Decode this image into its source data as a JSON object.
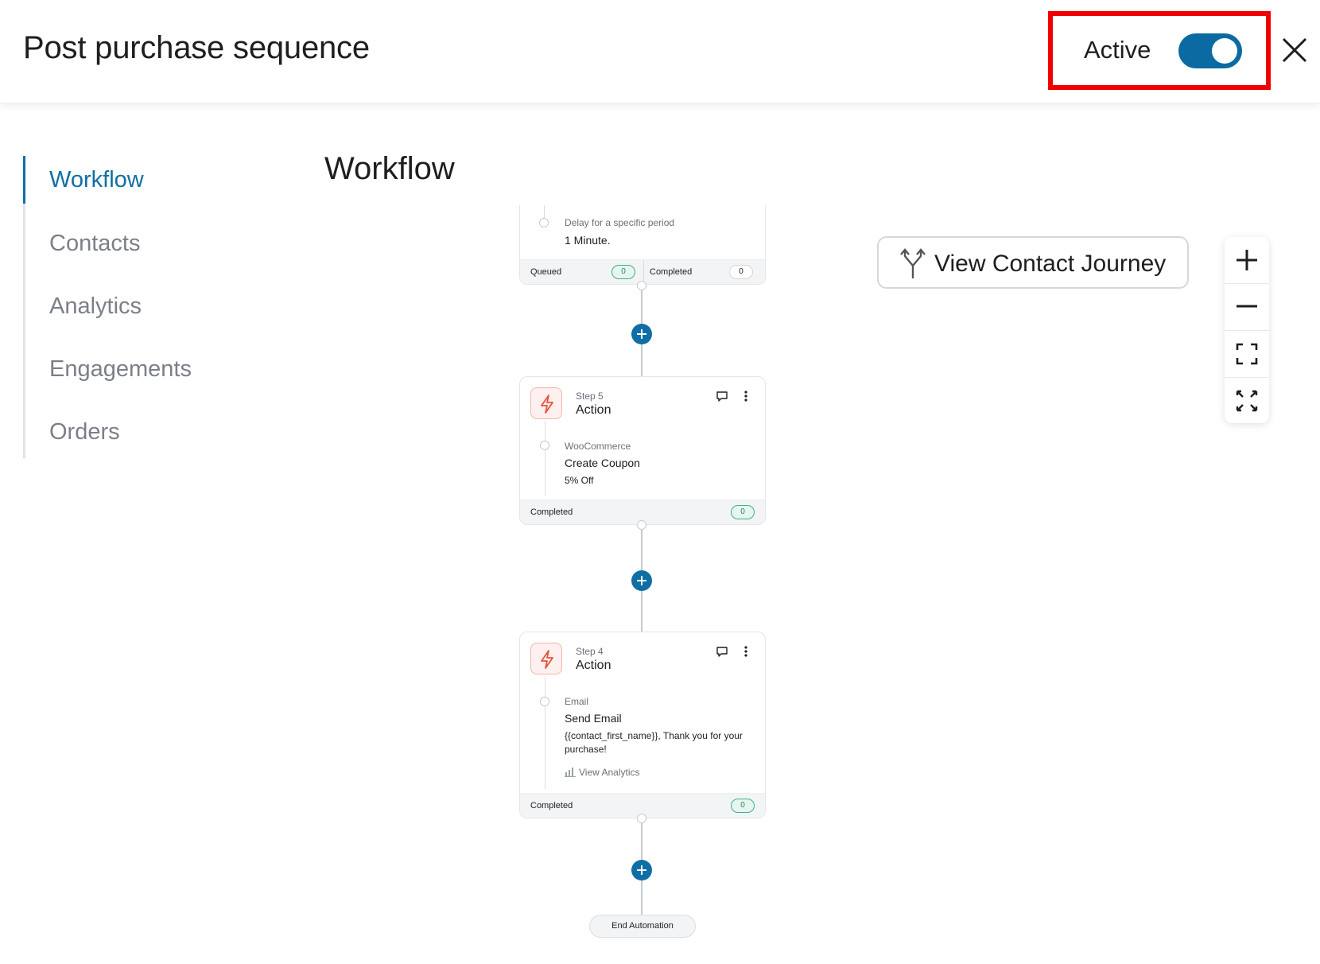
{
  "header": {
    "title": "Post purchase sequence",
    "active_label": "Active",
    "active": true
  },
  "sidebar": {
    "items": [
      {
        "label": "Workflow",
        "active": true
      },
      {
        "label": "Contacts"
      },
      {
        "label": "Analytics"
      },
      {
        "label": "Engagements"
      },
      {
        "label": "Orders"
      }
    ]
  },
  "workflow": {
    "title": "Workflow",
    "delay_card": {
      "label": "Delay for a specific period",
      "value": "1 Minute.",
      "queued_label": "Queued",
      "queued_count": "0",
      "completed_label": "Completed",
      "completed_count": "0"
    },
    "step5": {
      "step": "Step 5",
      "title": "Action",
      "category": "WooCommerce",
      "action": "Create Coupon",
      "detail": "5% Off",
      "completed_label": "Completed",
      "completed_count": "0"
    },
    "step4": {
      "step": "Step 4",
      "title": "Action",
      "category": "Email",
      "action": "Send Email",
      "detail": "{{contact_first_name}}, Thank you for your purchase!",
      "analytics_link": "View Analytics",
      "completed_label": "Completed",
      "completed_count": "0"
    },
    "end_label": "End Automation"
  },
  "journey_button": "View Contact Journey",
  "icons": {
    "close": "close-icon",
    "action": "lightning-icon",
    "comment": "comment-icon",
    "more": "more-vertical-icon",
    "analytics": "chart-icon",
    "journey": "split-arrows-icon",
    "zoom_in": "plus-icon",
    "zoom_out": "minus-icon",
    "fit": "fit-screen-icon",
    "fullscreen": "expand-icon"
  },
  "colors": {
    "accent": "#0f6fa4",
    "toggle": "#0a6aa1",
    "highlight": "#f10000",
    "action_icon": "#e5533d",
    "status_green": "#3bb18b"
  }
}
